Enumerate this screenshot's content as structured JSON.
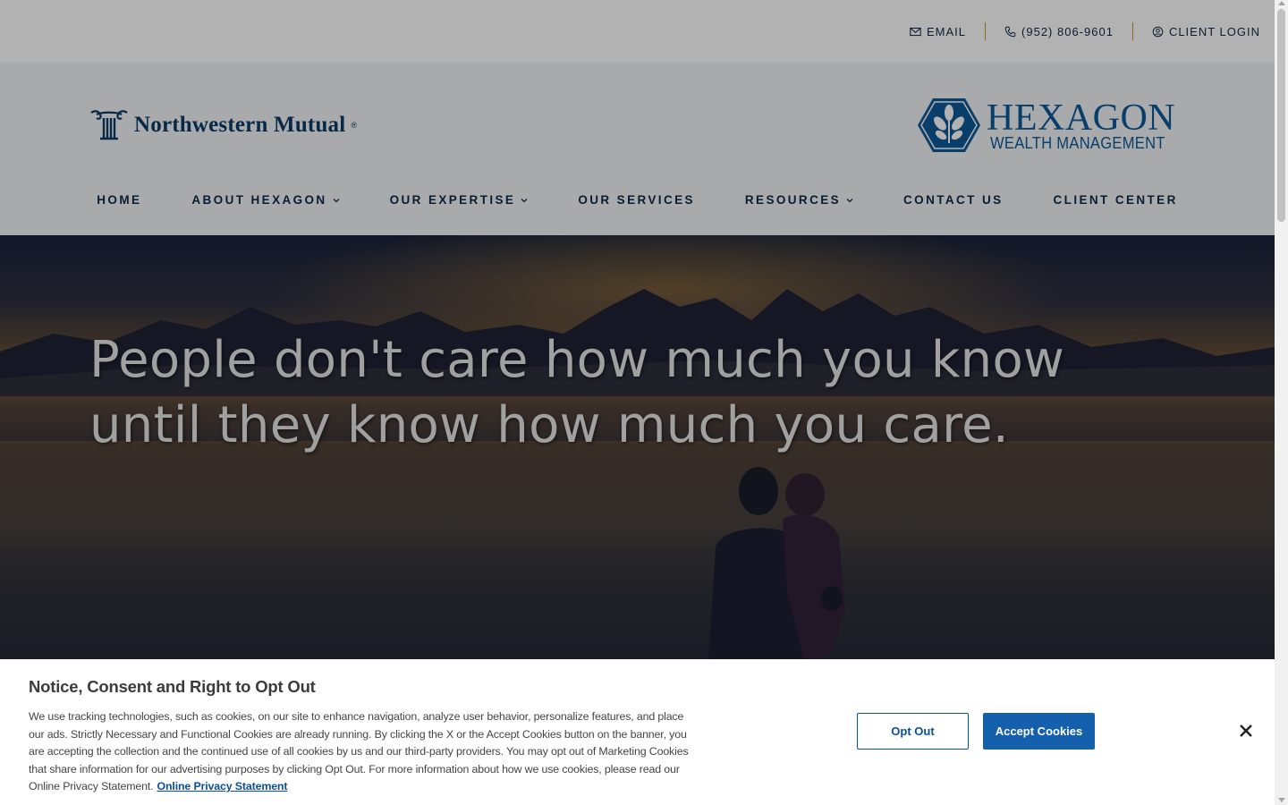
{
  "topbar": {
    "email_label": "EMAIL",
    "phone_label": "(952) 806-9601",
    "login_label": "CLIENT LOGIN"
  },
  "header": {
    "nm_logo_text": "Northwestern Mutual",
    "nm_logo_reg": "®",
    "hex_logo_title": "HEXAGON",
    "hex_logo_subtitle": "WEALTH MANAGEMENT"
  },
  "nav": {
    "items": [
      {
        "label": "HOME",
        "has_dropdown": false
      },
      {
        "label": "ABOUT HEXAGON",
        "has_dropdown": true
      },
      {
        "label": "OUR EXPERTISE",
        "has_dropdown": true
      },
      {
        "label": "OUR SERVICES",
        "has_dropdown": false
      },
      {
        "label": "RESOURCES",
        "has_dropdown": true
      },
      {
        "label": "CONTACT US",
        "has_dropdown": false
      },
      {
        "label": "CLIENT CENTER",
        "has_dropdown": false
      }
    ]
  },
  "hero": {
    "quote_line1": "People don't care how much you know",
    "quote_line2": "until they know how much you care."
  },
  "cookie": {
    "title": "Notice, Consent and Right to Opt Out",
    "body": "We use tracking technologies, such as cookies, on our site to enhance navigation, analyze user behavior, personalize features, and place our ads. Strictly Necessary and Functional Cookies are already running. By clicking the X or the Accept Cookies button on the banner, you are accepting the collection and the continued use of all cookies by us and our third-party providers. You may opt out of Marketing Cookies that share information for our advertising purposes by clicking Opt Out. For more information about how we use cookies, please read our Online Privacy Statement.",
    "link_label": "Online Privacy Statement",
    "opt_out_label": "Opt Out",
    "accept_label": "Accept Cookies"
  },
  "colors": {
    "navy": "#0e2a47",
    "brand_blue": "#0d5a99",
    "accent_gold": "#c79a2d",
    "button_blue": "#1460ad"
  }
}
